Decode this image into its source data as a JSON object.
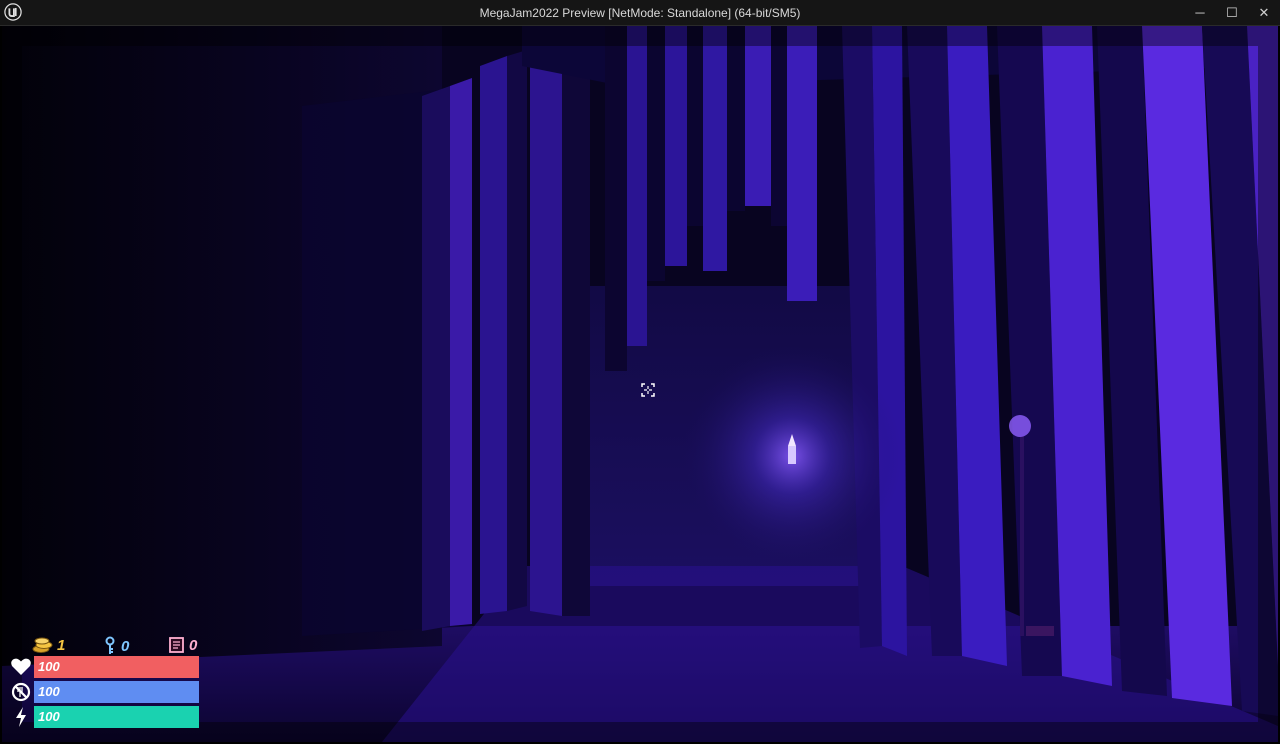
{
  "window": {
    "title": "MegaJam2022 Preview [NetMode: Standalone]  (64-bit/SM5)",
    "app_icon": "unreal-engine-logo",
    "controls": {
      "minimize": "─",
      "maximize": "☐",
      "close": "✕"
    }
  },
  "hud": {
    "coins": {
      "icon": "coin-stack-icon",
      "value": "1",
      "color": "#f5c542"
    },
    "keys": {
      "icon": "key-icon",
      "value": "0",
      "color": "#7fc6ff"
    },
    "notes": {
      "icon": "note-icon",
      "value": "0",
      "color": "#ffb0d0"
    },
    "health": {
      "icon": "heart-icon",
      "label": "100",
      "level": 1.0,
      "color": "#f15f61"
    },
    "hunger": {
      "icon": "no-food-icon",
      "label": "100",
      "level": 1.0,
      "color": "#5f8df2"
    },
    "energy": {
      "icon": "lightning-icon",
      "label": "100",
      "level": 1.0,
      "color": "#1ad2b0"
    }
  },
  "crosshair": {
    "icon": "crosshair-icon"
  }
}
